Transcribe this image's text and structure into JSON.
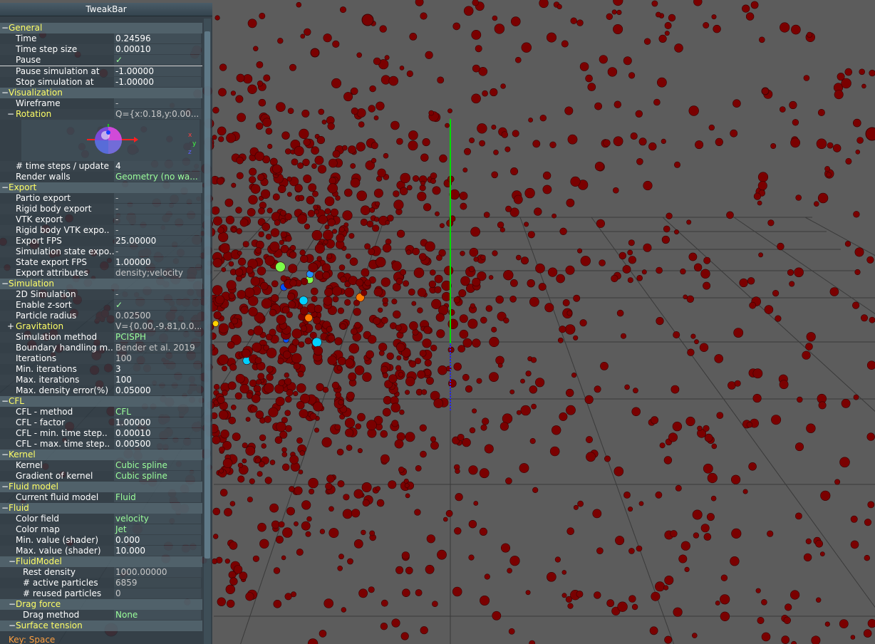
{
  "tweakbar": {
    "title": "TweakBar",
    "footer": "Key: Space",
    "rows": [
      {
        "kind": "group",
        "toggle": "−",
        "label": "General",
        "indent": 0
      },
      {
        "kind": "var",
        "label": "Time",
        "value": "0.24596",
        "style": "normal"
      },
      {
        "kind": "var",
        "label": "Time step size",
        "value": "0.00010",
        "style": "normal"
      },
      {
        "kind": "var",
        "label": "Pause",
        "value": "✓",
        "style": "check",
        "selected": true
      },
      {
        "kind": "var",
        "label": "Pause simulation at",
        "value": "-1.00000",
        "style": "normal"
      },
      {
        "kind": "var",
        "label": "Stop simulation at",
        "value": "-1.00000",
        "style": "normal"
      },
      {
        "kind": "group",
        "toggle": "−",
        "label": "Visualization",
        "indent": 0
      },
      {
        "kind": "var",
        "label": "Wireframe",
        "value": "-",
        "style": "dim"
      },
      {
        "kind": "subgroup",
        "toggle": "−",
        "label": "Rotation",
        "value": "Q={x:0.18,y:0.00...",
        "style": "ro"
      },
      {
        "kind": "rotation"
      },
      {
        "kind": "var",
        "label": "# time steps / update",
        "value": "4",
        "style": "normal"
      },
      {
        "kind": "var",
        "label": "Render walls",
        "value": "Geometry (no wa...",
        "style": "green"
      },
      {
        "kind": "group",
        "toggle": "−",
        "label": "Export",
        "indent": 0
      },
      {
        "kind": "var",
        "label": "Partio export",
        "value": "-",
        "style": "dim"
      },
      {
        "kind": "var",
        "label": "Rigid body export",
        "value": "-",
        "style": "dim"
      },
      {
        "kind": "var",
        "label": "VTK export",
        "value": "-",
        "style": "dim"
      },
      {
        "kind": "var",
        "label": "Rigid body VTK expo..",
        "value": "-",
        "style": "dim"
      },
      {
        "kind": "var",
        "label": "Export FPS",
        "value": "25.00000",
        "style": "normal"
      },
      {
        "kind": "var",
        "label": "Simulation state expo..",
        "value": "-",
        "style": "dim"
      },
      {
        "kind": "var",
        "label": "State export FPS",
        "value": "1.00000",
        "style": "normal"
      },
      {
        "kind": "var",
        "label": "Export attributes",
        "value": "density;velocity",
        "style": "ro"
      },
      {
        "kind": "group",
        "toggle": "−",
        "label": "Simulation",
        "indent": 0
      },
      {
        "kind": "var",
        "label": "2D Simulation",
        "value": "-",
        "style": "dim"
      },
      {
        "kind": "var",
        "label": "Enable z-sort",
        "value": "✓",
        "style": "check"
      },
      {
        "kind": "var",
        "label": "Particle radius",
        "value": "0.02500",
        "style": "ro"
      },
      {
        "kind": "subgroup",
        "toggle": "+",
        "label": "Gravitation",
        "value": "V={0.00,-9.81,0.0...",
        "style": "ro"
      },
      {
        "kind": "var",
        "label": "Simulation method",
        "value": "PCISPH",
        "style": "green"
      },
      {
        "kind": "var",
        "label": "Boundary handling m..",
        "value": "Bender et al. 2019",
        "style": "ro"
      },
      {
        "kind": "var",
        "label": "Iterations",
        "value": "100",
        "style": "ro"
      },
      {
        "kind": "var",
        "label": "Min. iterations",
        "value": "3",
        "style": "normal"
      },
      {
        "kind": "var",
        "label": "Max. iterations",
        "value": "100",
        "style": "normal"
      },
      {
        "kind": "var",
        "label": "Max. density error(%)",
        "value": "0.05000",
        "style": "normal"
      },
      {
        "kind": "group",
        "toggle": "−",
        "label": "CFL",
        "indent": 0
      },
      {
        "kind": "var",
        "label": "CFL - method",
        "value": "CFL",
        "style": "green"
      },
      {
        "kind": "var",
        "label": "CFL - factor",
        "value": "1.00000",
        "style": "normal"
      },
      {
        "kind": "var",
        "label": "CFL - min. time step..",
        "value": "0.00010",
        "style": "normal"
      },
      {
        "kind": "var",
        "label": "CFL - max. time step..",
        "value": "0.00500",
        "style": "normal"
      },
      {
        "kind": "group",
        "toggle": "−",
        "label": "Kernel",
        "indent": 0
      },
      {
        "kind": "var",
        "label": "Kernel",
        "value": "Cubic spline",
        "style": "green"
      },
      {
        "kind": "var",
        "label": "Gradient of kernel",
        "value": "Cubic spline",
        "style": "green"
      },
      {
        "kind": "group",
        "toggle": "−",
        "label": "Fluid model",
        "indent": 0
      },
      {
        "kind": "var",
        "label": "Current fluid model",
        "value": "Fluid",
        "style": "green"
      },
      {
        "kind": "group",
        "toggle": "−",
        "label": "Fluid",
        "indent": 0
      },
      {
        "kind": "var",
        "label": "Color field",
        "value": "velocity",
        "style": "green"
      },
      {
        "kind": "var",
        "label": "Color map",
        "value": "Jet",
        "style": "green"
      },
      {
        "kind": "var",
        "label": "Min. value (shader)",
        "value": "0.000",
        "style": "normal"
      },
      {
        "kind": "var",
        "label": "Max. value (shader)",
        "value": "10.000",
        "style": "normal"
      },
      {
        "kind": "group",
        "toggle": "−",
        "label": "FluidModel",
        "indent": 1
      },
      {
        "kind": "var",
        "label": "Rest density",
        "value": "1000.00000",
        "style": "ro",
        "indent": 1
      },
      {
        "kind": "var",
        "label": "# active particles",
        "value": "6859",
        "style": "ro",
        "indent": 1
      },
      {
        "kind": "var",
        "label": "# reused particles",
        "value": "0",
        "style": "ro",
        "indent": 1
      },
      {
        "kind": "group",
        "toggle": "−",
        "label": "Drag force",
        "indent": 1
      },
      {
        "kind": "var",
        "label": "Drag method",
        "value": "None",
        "style": "green",
        "indent": 1
      },
      {
        "kind": "group",
        "toggle": "−",
        "label": "Surface tension",
        "indent": 1
      }
    ]
  },
  "scene": {
    "particle_color": "#7a0000",
    "axis_y_color": "#00dd00",
    "axis_z_color": "#2a2aff",
    "grid_color": "#3a3a3a",
    "background": "#5c5c5c"
  }
}
